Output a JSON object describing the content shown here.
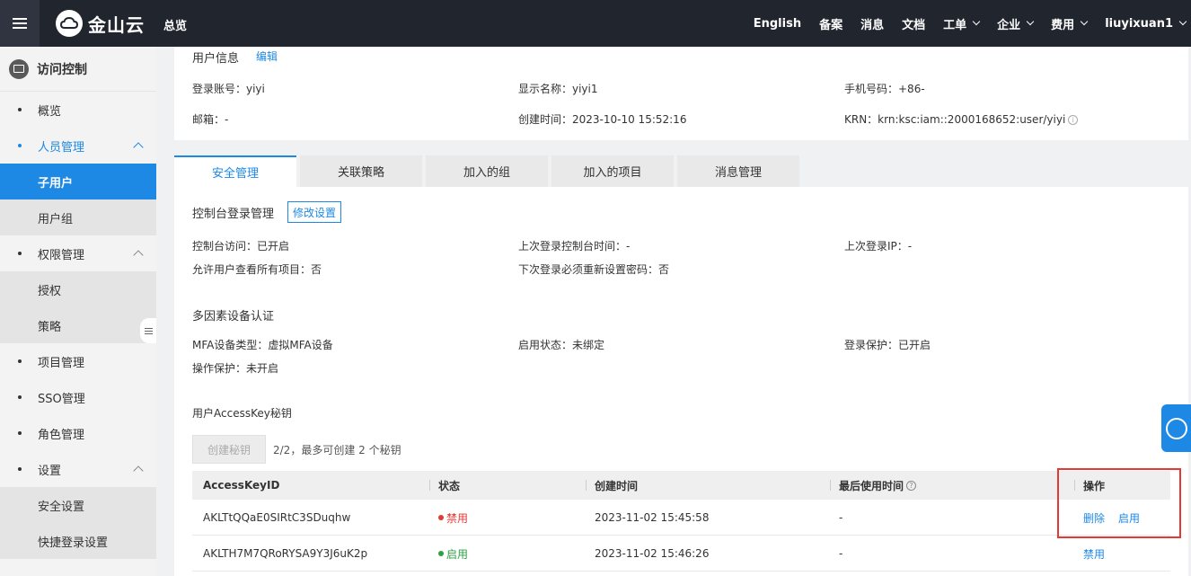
{
  "topbar": {
    "brand": "金山云",
    "overview": "总览",
    "nav": [
      "English",
      "备案",
      "消息",
      "文档"
    ],
    "nav_dropdowns": [
      "工单",
      "企业",
      "费用",
      "liuyixuan1"
    ]
  },
  "sidebar": {
    "title": "访问控制",
    "items": [
      {
        "label": "概览"
      },
      {
        "label": "人员管理"
      },
      {
        "label": "子用户"
      },
      {
        "label": "用户组"
      },
      {
        "label": "权限管理"
      },
      {
        "label": "授权"
      },
      {
        "label": "策略"
      },
      {
        "label": "项目管理"
      },
      {
        "label": "SSO管理"
      },
      {
        "label": "角色管理"
      },
      {
        "label": "设置"
      },
      {
        "label": "安全设置"
      },
      {
        "label": "快捷登录设置"
      }
    ]
  },
  "user_info": {
    "title": "用户信息",
    "edit": "编辑",
    "login_account": "登录账号：yiyi",
    "display_name": "显示名称：yiyi1",
    "phone": "手机号码：+86-",
    "email": "邮箱：-",
    "created": "创建时间：2023-10-10 15:52:16",
    "krn": "KRN：krn:ksc:iam::2000168652:user/yiyi"
  },
  "tabs": [
    "安全管理",
    "关联策略",
    "加入的组",
    "加入的项目",
    "消息管理"
  ],
  "console": {
    "title": "控制台登录管理",
    "modify_btn": "修改设置",
    "access": "控制台访问：已开启",
    "last_login_time": "上次登录控制台时间：-",
    "last_login_ip": "上次登录IP：-",
    "view_all_projects": "允许用户查看所有项目：否",
    "reset_pwd": "下次登录必须重新设置密码：否"
  },
  "mfa": {
    "title": "多因素设备认证",
    "type": "MFA设备类型：虚拟MFA设备",
    "status": "启用状态：未绑定",
    "login_protect": "登录保护：已开启",
    "op_protect": "操作保护：未开启"
  },
  "accesskey": {
    "title": "用户AccessKey秘钥",
    "create_btn": "创建秘钥",
    "note": "2/2，最多可创建 2 个秘钥",
    "columns": [
      "AccessKeyID",
      "状态",
      "创建时间",
      "最后使用时间",
      "操作"
    ],
    "rows": [
      {
        "id": "AKLTtQQaE0SIRtC3SDuqhw",
        "status": "禁用",
        "status_color": "#e53935",
        "created": "2023-11-02 15:45:58",
        "last_used": "-",
        "actions": [
          "删除",
          "启用"
        ]
      },
      {
        "id": "AKLTH7M7QRoRYSA9Y3J6uK2p",
        "status": "启用",
        "status_color": "#2ea043",
        "created": "2023-11-02 15:46:26",
        "last_used": "-",
        "actions": [
          "禁用"
        ]
      }
    ]
  }
}
